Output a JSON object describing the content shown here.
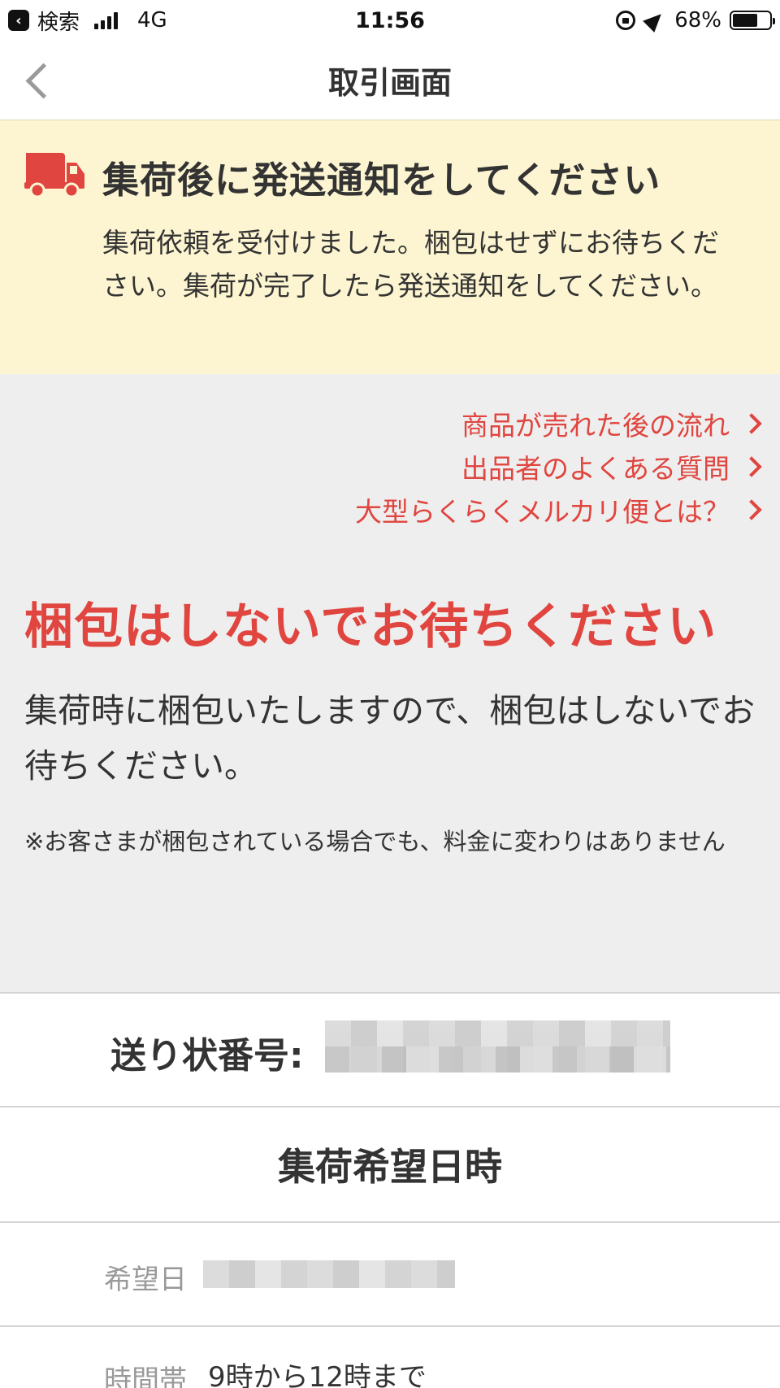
{
  "status_bar": {
    "back_app": "検索",
    "network": "4G",
    "time": "11:56",
    "battery": "68%",
    "battery_level": 0.68,
    "icons": [
      "back-app-icon",
      "signal-icon",
      "rotation-lock-icon",
      "location-icon",
      "battery-icon"
    ]
  },
  "nav": {
    "title": "取引画面",
    "back_icon": "chevron-left-icon"
  },
  "banner": {
    "icon": "truck-icon",
    "title": "集荷後に発送通知をしてください",
    "text": "集荷依頼を受付けました。梱包はせずにお待ちください。集荷が完了したら発送通知をしてください。"
  },
  "help_links": [
    {
      "label": "商品が売れた後の流れ"
    },
    {
      "label": "出品者のよくある質問"
    },
    {
      "label": "大型らくらくメルカリ便とは？"
    }
  ],
  "notice": {
    "title": "梱包はしないでお待ちください",
    "text": "集荷時に梱包いたしますので、梱包はしないでお待ちください。",
    "note": "※お客さまが梱包されている場合でも、料金に変わりはありません"
  },
  "tracking": {
    "label": "送り状番号:"
  },
  "pickup": {
    "title": "集荷希望日時",
    "date_label": "希望日",
    "time_label": "時間帯",
    "time_value": "9時から12時まで"
  },
  "colors": {
    "accent_red": "#e0453f",
    "banner_bg": "#fdf5d1",
    "grey_bg": "#eeeeee"
  }
}
